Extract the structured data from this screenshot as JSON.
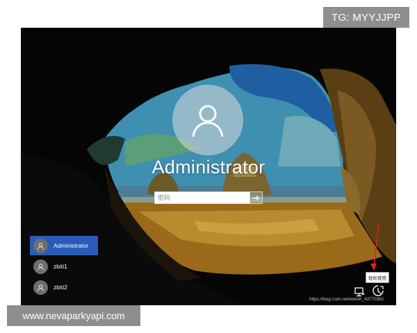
{
  "watermark": {
    "tg_label": "TG: MYYJJPP",
    "site_label": "www.nevaparkyapi.com"
  },
  "login": {
    "username": "Administrator",
    "password_placeholder": "密码",
    "submit_icon": "arrow-right-icon",
    "avatar_icon": "user-silhouette-icon"
  },
  "user_list": [
    {
      "name": "Administrator",
      "selected": true
    },
    {
      "name": "zbiti1",
      "selected": false
    },
    {
      "name": "zbiti2",
      "selected": false
    }
  ],
  "system_tray": {
    "tooltip": "轻松使用",
    "icons": [
      "network-icon",
      "ease-of-access-icon"
    ]
  },
  "image_credit": "https://blog.csdn.net/weixin_43770382",
  "colors": {
    "selected_user_bg": "#2a5bb8",
    "annotation_arrow": "#e02020"
  }
}
